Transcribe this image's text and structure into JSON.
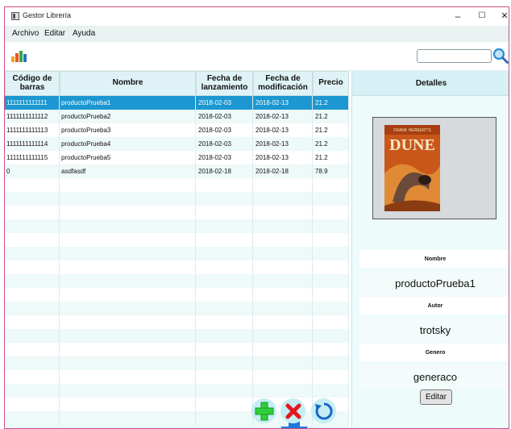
{
  "window": {
    "title": "Gestor Librería",
    "controls": {
      "minimize": "–",
      "maximize": "☐",
      "close": "✕"
    }
  },
  "menu": [
    "Archivo",
    "Editar",
    "Ayuda"
  ],
  "toolbar": {
    "stats_icon": "bar-chart-icon",
    "search": {
      "value": "",
      "placeholder": ""
    },
    "search_icon": "magnifier-icon"
  },
  "table": {
    "columns": [
      "Código de barras",
      "Nombre",
      "Fecha de lanzamiento",
      "Fecha de modificación",
      "Precio"
    ],
    "rows": [
      [
        "1111111111111",
        "productoPrueba1",
        "2018-02-03",
        "2018-02-13",
        "21.2"
      ],
      [
        "1111111111112",
        "productoPrueba2",
        "2018-02-03",
        "2018-02-13",
        "21.2"
      ],
      [
        "1111111111113",
        "productoPrueba3",
        "2018-02-03",
        "2018-02-13",
        "21.2"
      ],
      [
        "1111111111114",
        "productoPrueba4",
        "2018-02-03",
        "2018-02-13",
        "21.2"
      ],
      [
        "1111111111115",
        "productoPrueba5",
        "2018-02-03",
        "2018-02-13",
        "21.2"
      ],
      [
        "0",
        "asdfasdf",
        "2018-02-18",
        "2018-02-18",
        "78.9"
      ]
    ],
    "selected_row": 0,
    "empty_rows": 18
  },
  "actions": {
    "add": "plus-icon",
    "delete": "x-icon",
    "refresh": "refresh-icon",
    "highlight": "arrow-down-icon",
    "colors": {
      "add": "#2fcf3a",
      "delete": "#e0191f",
      "refresh": "#1a66c9",
      "highlight": "#1f78d9"
    }
  },
  "details": {
    "header": "Detalles",
    "cover": {
      "author_line": "FRANK HERBERT'S",
      "title": "DUNE"
    },
    "fields": [
      {
        "label": "Nombre",
        "value": "productoPrueba1"
      },
      {
        "label": "Autor",
        "value": "trotsky"
      },
      {
        "label": "Genero",
        "value": "generaco"
      }
    ],
    "edit_label": "Editar"
  },
  "colors": {
    "selection": "#1c97d1",
    "panel": "#eaf8f8",
    "header": "#dff3f6"
  }
}
